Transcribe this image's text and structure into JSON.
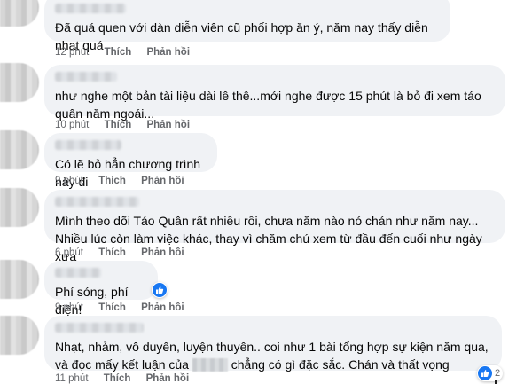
{
  "comments": [
    {
      "text": "Đã quá quen với dàn diễn viên cũ phối hợp ăn ý, năm nay thấy diễn nhạt quá",
      "time": "12 phút",
      "like": "Thích",
      "reply": "Phản hồi"
    },
    {
      "text": "như nghe một bản tài liệu dài lê thê...mới nghe được 15 phút là bỏ đi xem táo quân năm ngoái...",
      "time": "10 phút",
      "like": "Thích",
      "reply": "Phản hồi"
    },
    {
      "text": "Có lẽ bỏ hẳn chương trình này đi",
      "time": "9 phút",
      "like": "Thích",
      "reply": "Phản hồi"
    },
    {
      "text": "Mình theo dõi Táo Quân rất nhiều rồi, chưa năm nào nó chán như năm nay... Nhiều lúc còn làm việc khác, thay vì chăm chú xem từ đầu đến cuối như ngày xưa",
      "time": "6 phút",
      "like": "Thích",
      "reply": "Phản hồi"
    },
    {
      "text": "Phí sóng, phí điện!",
      "time": "9 phút",
      "like": "Thích",
      "reply": "Phản hồi"
    },
    {
      "text_part1": "Nhạt, nhảm, vô duyên, luyện thuyên.. coi như 1 bài tổng hợp sự kiện năm qua, và đọc mấy kết luận của",
      "text_part2": "chẳng có gì đặc sắc. Chán và thất vọng",
      "time": "11 phút",
      "like": "Thích",
      "reply": "Phản hồi",
      "reaction_count": "2"
    }
  ],
  "colors": {
    "bubble": "#f0f2f5",
    "meta": "#65676b",
    "like": "#1877f2"
  }
}
